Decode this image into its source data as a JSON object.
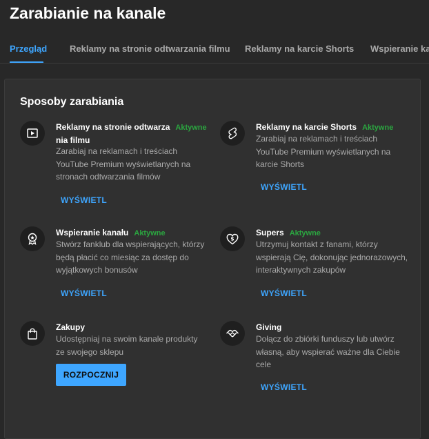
{
  "page": {
    "title": "Zarabianie na kanale"
  },
  "tabs": [
    {
      "label": "Przegląd",
      "active": true
    },
    {
      "label": "Reklamy na stronie odtwarzania filmu",
      "active": false
    },
    {
      "label": "Reklamy na karcie Shorts",
      "active": false
    },
    {
      "label": "Wspieranie kanału",
      "active": false
    }
  ],
  "section": {
    "title": "Sposoby zarabiania"
  },
  "items": [
    {
      "icon": "play-icon",
      "title_line1": "Reklamy na stronie odtwarza",
      "title_line2": "nia filmu",
      "badge": "Aktywne",
      "desc": [
        "Zarabiaj na reklamach i treściach",
        "YouTube Premium wyświetlanych na",
        "stronach odtwarzania filmów"
      ],
      "action": "WYŚWIETL"
    },
    {
      "icon": "shorts-icon",
      "title_line1": "Reklamy na karcie Shorts",
      "badge": "Aktywne",
      "desc": [
        "Zarabiaj na reklamach i treściach",
        "YouTube Premium wyświetlanych na",
        "karcie Shorts"
      ],
      "action": "WYŚWIETL"
    },
    {
      "icon": "membership-badge-icon",
      "title_line1": "Wspieranie kanału",
      "badge": "Aktywne",
      "desc": [
        "Stwórz fanklub dla wspierających, którzy",
        "będą płacić co miesiąc za dostęp do",
        "wyjątkowych bonusów"
      ],
      "action": "WYŚWIETL"
    },
    {
      "icon": "supers-heart-icon",
      "title_line1": "Supers",
      "badge": "Aktywne",
      "desc": [
        "Utrzymuj kontakt z fanami, którzy",
        "wspierają Cię, dokonując jednorazowych,",
        "interaktywnych zakupów"
      ],
      "action": "WYŚWIETL"
    },
    {
      "icon": "shopping-bag-icon",
      "title_line1": "Zakupy",
      "desc": [
        "Udostępniaj na swoim kanale produkty",
        "ze swojego sklepu"
      ],
      "action": "ROZPOCZNIJ"
    },
    {
      "icon": "giving-hands-icon",
      "title_line1": "Giving",
      "desc": [
        "Dołącz do zbiórki funduszy lub utwórz",
        "własną, aby wspierać ważne dla Ciebie",
        "cele"
      ],
      "action": "WYŚWIETL"
    }
  ],
  "colors": {
    "background": "#282828",
    "card": "#303030",
    "accent": "#3ea6ff",
    "active_badge": "#2ba640"
  }
}
